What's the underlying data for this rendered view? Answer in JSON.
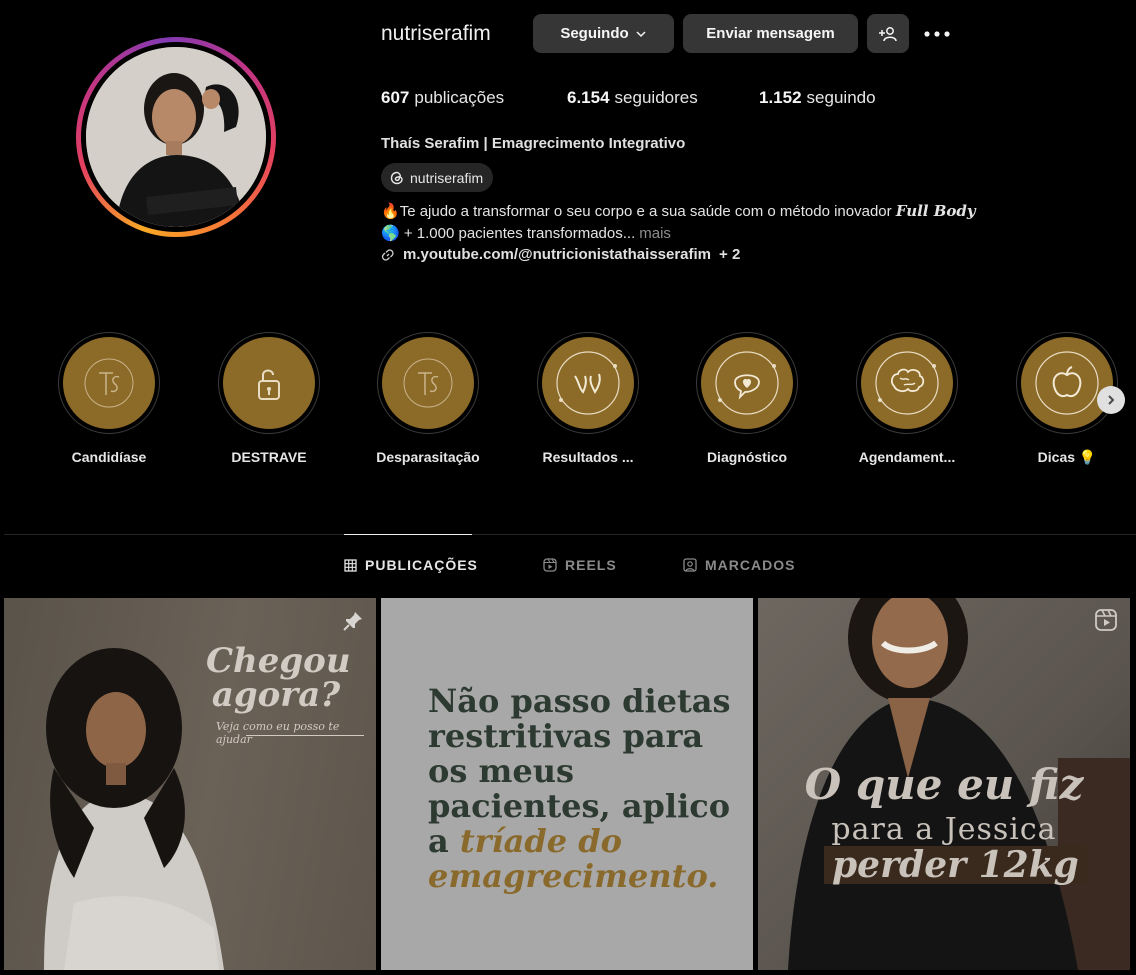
{
  "profile": {
    "username": "nutriserafim",
    "following_label": "Seguindo",
    "message_label": "Enviar mensagem",
    "stats": {
      "posts_count": "607",
      "posts_label": "publicações",
      "followers_count": "6.154",
      "followers_label": "seguidores",
      "following_count": "1.152",
      "following_label": "seguindo"
    },
    "full_name": "Thaís Serafim | Emagrecimento Integrativo",
    "threads_handle": "nutriserafim",
    "bio_line1_emoji": "🔥",
    "bio_line1": "Te ajudo a transformar o seu corpo e a sua saúde com o método inovador ",
    "bio_line1_emphasis": "Full Body",
    "bio_line2_emoji": "🌎",
    "bio_line2": " + 1.000 pacientes transformados...",
    "more_label": "mais",
    "link": "m.youtube.com/@nutricionistathaisserafim",
    "link_extra": "+ 2"
  },
  "highlights": [
    {
      "label": "Candidíase",
      "icon": "ts-logo-icon"
    },
    {
      "label": "DESTRAVE",
      "icon": "unlock-icon"
    },
    {
      "label": "Desparasitação",
      "icon": "ts-logo-icon"
    },
    {
      "label": "Resultados ...",
      "icon": "body-outline-icon"
    },
    {
      "label": "Diagnóstico",
      "icon": "heart-chat-icon"
    },
    {
      "label": "Agendament...",
      "icon": "brain-icon"
    },
    {
      "label": "Dicas 💡",
      "icon": "apple-icon"
    }
  ],
  "tabs": [
    {
      "label": "PUBLICAÇÕES",
      "icon": "grid-icon",
      "active": true
    },
    {
      "label": "REELS",
      "icon": "reels-icon",
      "active": false
    },
    {
      "label": "MARCADOS",
      "icon": "tagged-icon",
      "active": false
    }
  ],
  "posts": {
    "post1": {
      "title_line1": "Chegou",
      "title_line2": "agora?",
      "subtitle": "Veja como eu posso te ajudar"
    },
    "post2": {
      "text_plain": "Não passo dietas restritivas para os meus pacientes, aplico a ",
      "text_gold": "tríade do emagrecimento."
    },
    "post3": {
      "line1": "O que eu fiz",
      "line2": "para a Jessica",
      "line3": "perder 12kg"
    }
  },
  "colors": {
    "background": "#000000",
    "button_bg": "#363636",
    "highlight_gold": "#8c6a28",
    "muted_text": "#8e8e8e"
  }
}
